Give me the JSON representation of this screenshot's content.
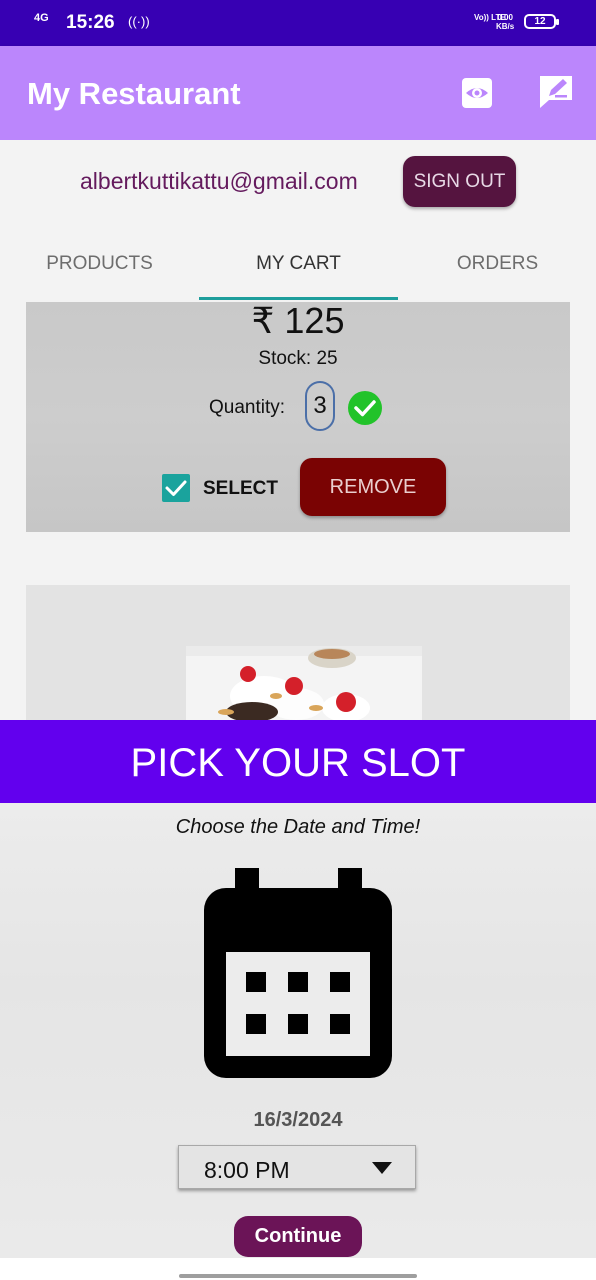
{
  "status_bar": {
    "network": "4G",
    "time": "15:26",
    "hotspot_glyph": "((·))",
    "volte": "Vo)) LTE",
    "speed_value": "0.00",
    "speed_unit": "KB/s",
    "battery": "12"
  },
  "app_bar": {
    "title": "My Restaurant",
    "icons": [
      "eye-icon",
      "edit-icon"
    ]
  },
  "account": {
    "email": "albertkuttikattu@gmail.com",
    "sign_out_label": "SIGN OUT"
  },
  "tabs": [
    {
      "label": "PRODUCTS",
      "active": false
    },
    {
      "label": "MY CART",
      "active": true
    },
    {
      "label": "ORDERS",
      "active": false
    }
  ],
  "cart_item": {
    "price": "₹ 125",
    "stock": "Stock: 25",
    "quantity_label": "Quantity:",
    "quantity_value": "3",
    "select_label": "SELECT",
    "selected": true,
    "remove_label": "REMOVE"
  },
  "slot_dialog": {
    "title": "PICK YOUR SLOT",
    "subtitle": "Choose the Date and Time!",
    "date": "16/3/2024",
    "time": "8:00 PM",
    "continue_label": "Continue"
  },
  "colors": {
    "status_bar": "#3700b3",
    "app_bar": "#bb86fc",
    "slot_header": "#6200ee",
    "tab_indicator": "#1e9e9c",
    "remove_button": "#7a0303",
    "continue_button": "#6b1457",
    "sign_out_button": "#55143f"
  }
}
